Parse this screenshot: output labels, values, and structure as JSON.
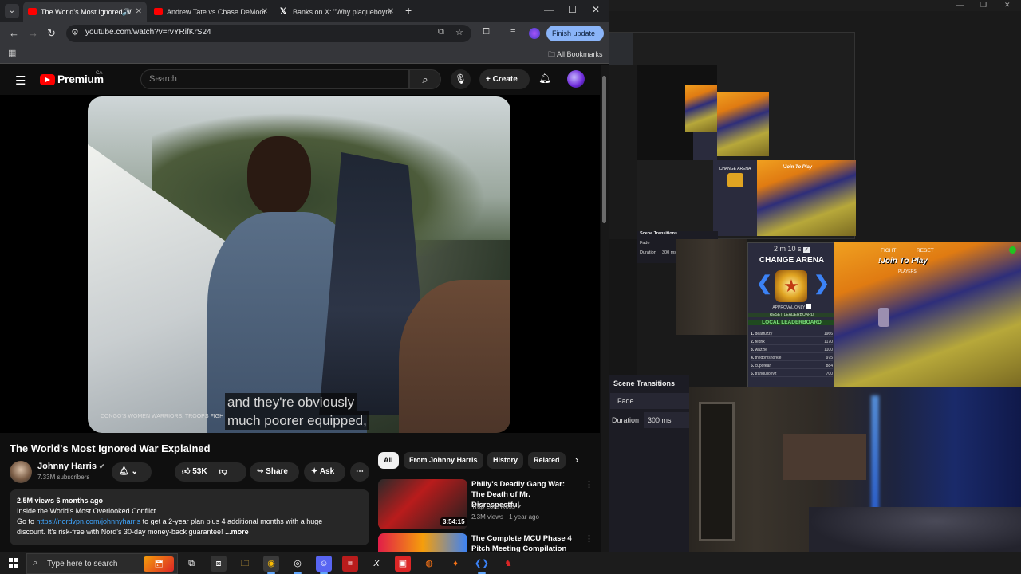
{
  "browser": {
    "tabs": [
      {
        "title": "The World's Most Ignored W",
        "active": true
      },
      {
        "title": "Andrew Tate vs Chase DeMoor",
        "active": false
      },
      {
        "title": "Banks on X: \"Why plaqueboym",
        "active": false
      }
    ],
    "url": "youtube.com/watch?v=rvYRifKrS24",
    "finish_update": "Finish update",
    "all_bookmarks": "All Bookmarks"
  },
  "youtube": {
    "logo_text": "Premium",
    "country": "CA",
    "search_placeholder": "Search",
    "create_label": "Create",
    "caption_line1": "and they're obviously",
    "caption_line2": "much poorer equipped,",
    "lower_third": "CONGO'S WOMEN WARRIORS: TROOPS FIGH",
    "video_title": "The World's Most Ignored War Explained",
    "channel_name": "Johnny Harris",
    "subscribers": "7.33M subscribers",
    "likes": "53K",
    "share_label": "Share",
    "ask_label": "Ask",
    "description": {
      "stats": "2.5M views  6 months ago",
      "line1": "Inside the World's Most Overlooked Conflict",
      "line2_prefix": "Go to ",
      "link": "https://nordvpn.com/johnnyharris",
      "line2_suffix": " to get a 2-year plan plus 4 additional months with a huge",
      "line3": "discount. It's risk-free with Nord's 30-day money-back guarantee!",
      "more": " ...more"
    },
    "chips": [
      "All",
      "From Johnny Harris",
      "History",
      "Related"
    ],
    "recommendations": [
      {
        "title": "Philly's Deadly Gang War: The Death of Mr. Disrespectful",
        "channel": "Trap Lore Ross",
        "meta": "2.3M views · 1 year ago",
        "duration": "3:54:15"
      },
      {
        "title": "The Complete MCU Phase 4 Pitch Meeting Compilation",
        "channel": "",
        "meta": "",
        "duration": ""
      }
    ]
  },
  "obs": {
    "scene_transitions": "Scene Transitions",
    "transition": "Fade",
    "duration_label": "Duration",
    "duration_value": "300 ms",
    "timer": "2 m 10 s",
    "change_arena": "CHANGE ARENA",
    "approval_only": "APPROVAL ONLY",
    "reset_leaderboard": "RESET LEADERBOARD",
    "local_leaderboard": "LOCAL LEADERBOARD",
    "fight": "FIGHT!",
    "reset": "RESET",
    "join_to_play": "!Join To Play",
    "players": "PLAYERS",
    "leaderboard": [
      {
        "rank": "1.",
        "name": "dearfuzzy",
        "score": "1966"
      },
      {
        "rank": "2.",
        "name": "fedrix",
        "score": "1170"
      },
      {
        "rank": "3.",
        "name": "wazzle",
        "score": "1100"
      },
      {
        "rank": "4.",
        "name": "thedomsnorkle",
        "score": "975"
      },
      {
        "rank": "5.",
        "name": "cupofear",
        "score": "884"
      },
      {
        "rank": "6.",
        "name": "tranquiloeyz",
        "score": "700"
      }
    ]
  },
  "taskbar": {
    "search_placeholder": "Type here to search"
  }
}
